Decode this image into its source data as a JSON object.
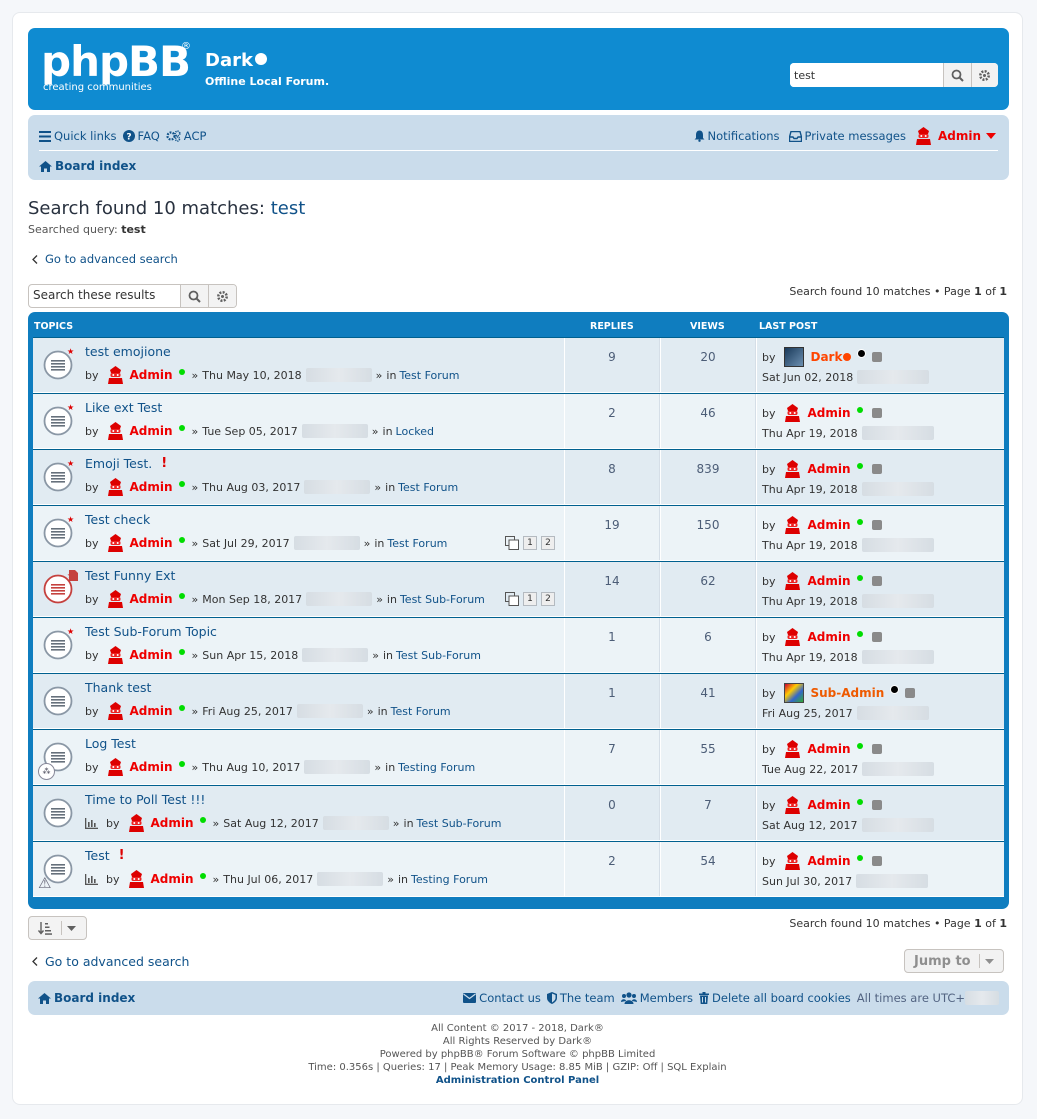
{
  "header": {
    "logo_text": "phpBB",
    "logo_tagline": "creating communities",
    "site_name": "Dark",
    "site_description": "Offline Local Forum.",
    "search_value": "test"
  },
  "navbar": {
    "quick_links": "Quick links",
    "faq": "FAQ",
    "acp": "ACP",
    "notifications": "Notifications",
    "private_messages": "Private messages",
    "user": "Admin",
    "board_index": "Board index"
  },
  "search": {
    "heading_prefix": "Search found 10 matches:",
    "heading_keyword": "test",
    "query_label": "Searched query:",
    "query_value": "test",
    "advanced_link": "Go to advanced search",
    "results_placeholder": "Search these results",
    "pagination_text": "Search found 10 matches • Page",
    "page_current": "1",
    "page_of": "of",
    "page_total": "1"
  },
  "table": {
    "col_topics": "TOPICS",
    "col_replies": "REPLIES",
    "col_views": "VIEWS",
    "col_lastpost": "LAST POST",
    "rows": [
      {
        "title": "test emojione",
        "by": "by",
        "author": "Admin",
        "date": "Thu May 10, 2018",
        "in": "in",
        "forum": "Test Forum",
        "replies": "9",
        "views": "20",
        "lp_by": "by",
        "lp_user": "Dark",
        "lp_date": "Sat Jun 02, 2018"
      },
      {
        "title": "Like ext Test",
        "by": "by",
        "author": "Admin",
        "date": "Tue Sep 05, 2017",
        "in": "in",
        "forum": "Locked",
        "replies": "2",
        "views": "46",
        "lp_by": "by",
        "lp_user": "Admin",
        "lp_date": "Thu Apr 19, 2018"
      },
      {
        "title": "Emoji Test.",
        "by": "by",
        "author": "Admin",
        "date": "Thu Aug 03, 2017",
        "in": "in",
        "forum": "Test Forum",
        "replies": "8",
        "views": "839",
        "lp_by": "by",
        "lp_user": "Admin",
        "lp_date": "Thu Apr 19, 2018"
      },
      {
        "title": "Test check",
        "by": "by",
        "author": "Admin",
        "date": "Sat Jul 29, 2017",
        "in": "in",
        "forum": "Test Forum",
        "replies": "19",
        "views": "150",
        "lp_by": "by",
        "lp_user": "Admin",
        "lp_date": "Thu Apr 19, 2018",
        "pages": [
          "1",
          "2"
        ]
      },
      {
        "title": "Test Funny Ext",
        "by": "by",
        "author": "Admin",
        "date": "Mon Sep 18, 2017",
        "in": "in",
        "forum": "Test Sub-Forum",
        "replies": "14",
        "views": "62",
        "lp_by": "by",
        "lp_user": "Admin",
        "lp_date": "Thu Apr 19, 2018",
        "pages": [
          "1",
          "2"
        ]
      },
      {
        "title": "Test Sub-Forum Topic",
        "by": "by",
        "author": "Admin",
        "date": "Sun Apr 15, 2018",
        "in": "in",
        "forum": "Test Sub-Forum",
        "replies": "1",
        "views": "6",
        "lp_by": "by",
        "lp_user": "Admin",
        "lp_date": "Thu Apr 19, 2018"
      },
      {
        "title": "Thank test",
        "by": "by",
        "author": "Admin",
        "date": "Fri Aug 25, 2017",
        "in": "in",
        "forum": "Test Forum",
        "replies": "1",
        "views": "41",
        "lp_by": "by",
        "lp_user": "Sub-Admin",
        "lp_date": "Fri Aug 25, 2017"
      },
      {
        "title": "Log Test",
        "by": "by",
        "author": "Admin",
        "date": "Thu Aug 10, 2017",
        "in": "in",
        "forum": "Testing Forum",
        "replies": "7",
        "views": "55",
        "lp_by": "by",
        "lp_user": "Admin",
        "lp_date": "Tue Aug 22, 2017"
      },
      {
        "title": "Time to Poll Test !!!",
        "by": "by",
        "author": "Admin",
        "date": "Sat Aug 12, 2017",
        "in": "in",
        "forum": "Test Sub-Forum",
        "replies": "0",
        "views": "7",
        "lp_by": "by",
        "lp_user": "Admin",
        "lp_date": "Sat Aug 12, 2017"
      },
      {
        "title": "Test",
        "by": "by",
        "author": "Admin",
        "date": "Thu Jul 06, 2017",
        "in": "in",
        "forum": "Testing Forum",
        "replies": "2",
        "views": "54",
        "lp_by": "by",
        "lp_user": "Admin",
        "lp_date": "Sun Jul 30, 2017"
      }
    ]
  },
  "bottom": {
    "jump_to": "Jump to"
  },
  "footer": {
    "board_index": "Board index",
    "contact_us": "Contact us",
    "the_team": "The team",
    "members": "Members",
    "delete_cookies": "Delete all board cookies",
    "timezone": "All times are UTC+",
    "copy1": "All Content © 2017 - 2018, Dark®",
    "copy2": "All Rights Reserved by Dark®",
    "copy3": "Powered by phpBB® Forum Software © phpBB Limited",
    "copy4": "Time: 0.356s | Queries: 17 | Peak Memory Usage: 8.85 MiB | GZIP: Off | SQL Explain",
    "acp_link": "Administration Control Panel"
  },
  "colors": {
    "header_blue": "#0f8bd1",
    "nav_bg": "#cadceb",
    "link": "#105289",
    "admin_red": "#ee0000",
    "online_green": "#00dd00"
  }
}
